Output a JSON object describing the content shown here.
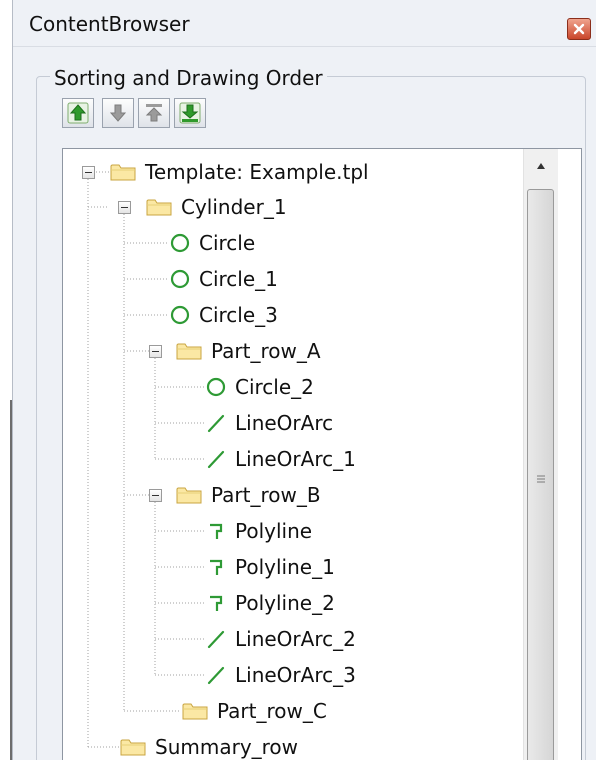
{
  "window": {
    "title": "ContentBrowser",
    "close_icon": "close-icon"
  },
  "group": {
    "label": "Sorting and Drawing Order"
  },
  "toolbar": {
    "buttons": [
      {
        "name": "move-up-button",
        "icon": "arrow-up-icon",
        "enabled": true
      },
      {
        "name": "move-down-button",
        "icon": "arrow-down-icon",
        "enabled": false
      },
      {
        "name": "move-top-button",
        "icon": "arrow-top-icon",
        "enabled": false
      },
      {
        "name": "move-bottom-button",
        "icon": "arrow-bottom-icon",
        "enabled": true
      }
    ]
  },
  "tree": {
    "nodes": [
      {
        "label": "Template: Example.tpl",
        "type": "folder",
        "depth": 0
      },
      {
        "label": "Cylinder_1",
        "type": "folder",
        "depth": 1
      },
      {
        "label": "Circle",
        "type": "circle",
        "depth": 2
      },
      {
        "label": "Circle_1",
        "type": "circle",
        "depth": 2
      },
      {
        "label": "Circle_3",
        "type": "circle",
        "depth": 2
      },
      {
        "label": "Part_row_A",
        "type": "folder",
        "depth": 2
      },
      {
        "label": "Circle_2",
        "type": "circle",
        "depth": 3
      },
      {
        "label": "LineOrArc",
        "type": "line",
        "depth": 3
      },
      {
        "label": "LineOrArc_1",
        "type": "line",
        "depth": 3
      },
      {
        "label": "Part_row_B",
        "type": "folder",
        "depth": 2
      },
      {
        "label": "Polyline",
        "type": "polyline",
        "depth": 3
      },
      {
        "label": "Polyline_1",
        "type": "polyline",
        "depth": 3
      },
      {
        "label": "Polyline_2",
        "type": "polyline",
        "depth": 3
      },
      {
        "label": "LineOrArc_2",
        "type": "line",
        "depth": 3
      },
      {
        "label": "LineOrArc_3",
        "type": "line",
        "depth": 3
      },
      {
        "label": "Part_row_C",
        "type": "folder",
        "depth": 2
      },
      {
        "label": "Summary_row",
        "type": "folder",
        "depth": 1
      }
    ]
  },
  "colors": {
    "panel_bg": "#eef1f6",
    "shape_green": "#2e9a35",
    "folder_fill": "#fbe8a4",
    "folder_stroke": "#c8a440"
  }
}
